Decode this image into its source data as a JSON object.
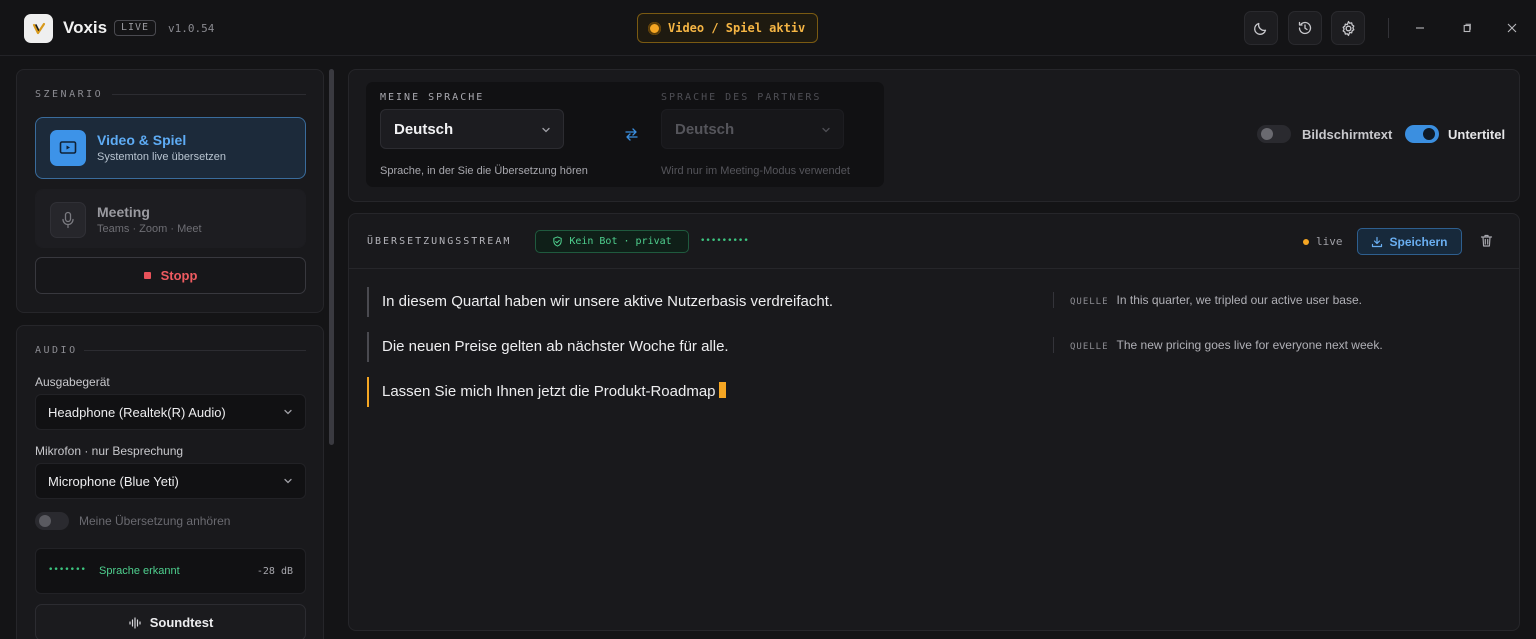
{
  "app": {
    "name": "Voxis",
    "tag": "LIVE",
    "version": "v1.0.54",
    "mode_status": "Video / Spiel aktiv"
  },
  "titlebar": {
    "theme_icon": "moon-icon",
    "history_icon": "history-icon",
    "settings_icon": "gear-icon"
  },
  "scenario": {
    "title": "SZENARIO",
    "options": [
      {
        "title": "Video & Spiel",
        "subtitle": "Systemton live übersetzen",
        "icon": "play-screen-icon",
        "active": true
      },
      {
        "title": "Meeting",
        "subtitle": "Teams · Zoom · Meet",
        "icon": "microphone-icon",
        "active": false
      }
    ],
    "stop_label": "Stopp"
  },
  "audio": {
    "title": "AUDIO",
    "output_label": "Ausgabegerät",
    "output_value": "Headphone (Realtek(R) Audio)",
    "mic_label": "Mikrofon · nur Besprechung",
    "mic_value": "Microphone (Blue Yeti)",
    "monitor_label": "Meine Übersetzung anhören",
    "monitor_on": false,
    "level_dots": "•••••••",
    "speech_status": "Sprache erkannt",
    "level_db": "-28 dB",
    "soundtest_label": "Soundtest"
  },
  "languages": {
    "mine_label": "MEINE SPRACHE",
    "mine_value": "Deutsch",
    "mine_hint": "Sprache, in der Sie die Übersetzung hören",
    "partner_label": "SPRACHE DES PARTNERS",
    "partner_value": "Deutsch",
    "partner_hint": "Wird nur im Meeting-Modus verwendet"
  },
  "options": {
    "screen_text_label": "Bildschirmtext",
    "screen_text_on": false,
    "subtitles_label": "Untertitel",
    "subtitles_on": true
  },
  "stream": {
    "title": "ÜBERSETZUNGSSTREAM",
    "badge": "Kein Bot · privat",
    "dots": "•••••••••",
    "live_label": "live",
    "save_label": "Speichern",
    "source_tag": "QUELLE",
    "lines": [
      {
        "text": "In diesem Quartal haben wir unsere aktive Nutzerbasis verdreifacht.",
        "source": "In this quarter, we tripled our active user base."
      },
      {
        "text": "Die neuen Preise gelten ab nächster Woche für alle.",
        "source": "The new pricing goes live for everyone next week."
      },
      {
        "text": "Lassen Sie mich Ihnen jetzt die Produkt-Roadmap",
        "source": ""
      }
    ]
  },
  "colors": {
    "accent": "#3b8fe0",
    "warning": "#f5a623",
    "success": "#3cc47f",
    "danger": "#ef5b60"
  }
}
